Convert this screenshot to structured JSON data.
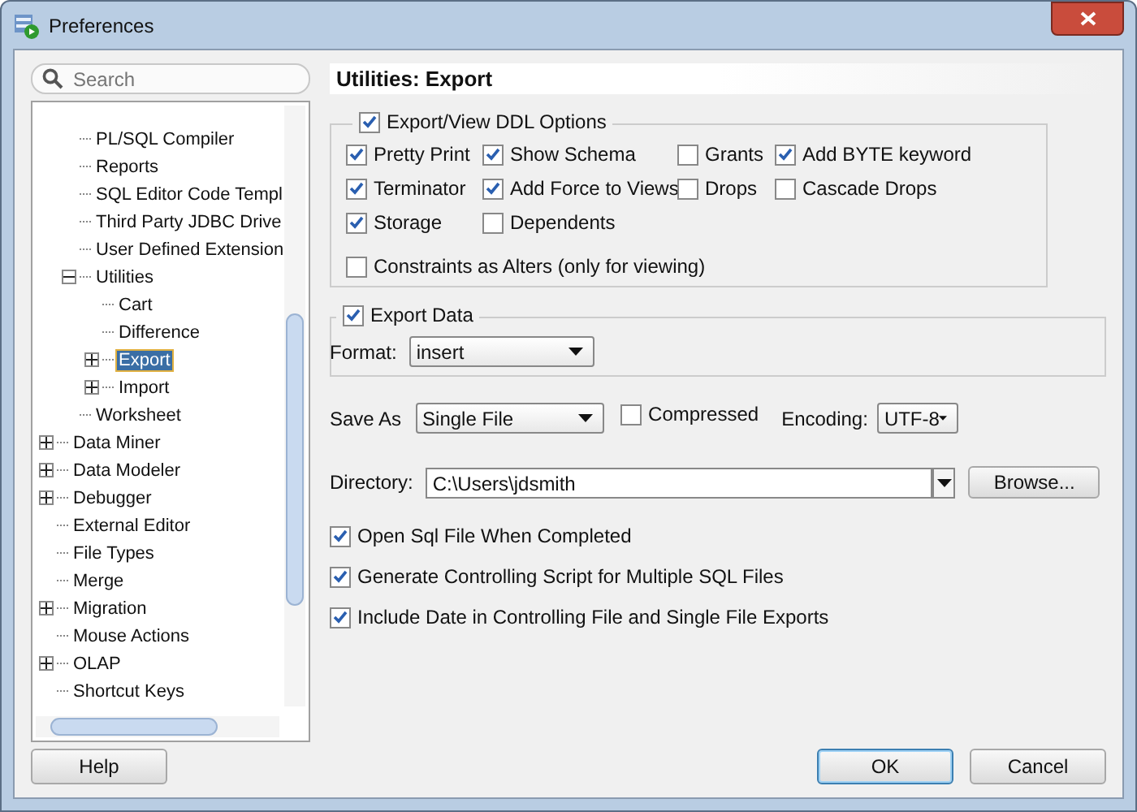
{
  "window": {
    "title": "Preferences"
  },
  "search": {
    "placeholder": "Search"
  },
  "tree": [
    {
      "children": [
        {
          "label": "PL/SQL Compiler",
          "selected": false
        },
        {
          "label": "Reports",
          "selected": false
        },
        {
          "label": "SQL Editor Code Templ",
          "selected": false
        },
        {
          "label": "Third Party JDBC Drive",
          "selected": false
        },
        {
          "label": "User Defined Extension",
          "selected": false
        },
        {
          "label": "Utilities",
          "selected": false,
          "expanded": true,
          "children": [
            {
              "label": "Cart",
              "selected": false
            },
            {
              "label": "Difference",
              "selected": false
            },
            {
              "label": "Export",
              "selected": true,
              "expanded": false
            },
            {
              "label": "Import",
              "selected": false,
              "expanded": false
            }
          ]
        },
        {
          "label": "Worksheet",
          "selected": false
        }
      ]
    },
    {
      "label": "Data Miner",
      "selected": false,
      "expanded": false
    },
    {
      "label": "Data Modeler",
      "selected": false,
      "expanded": false
    },
    {
      "label": "Debugger",
      "selected": false,
      "expanded": false
    },
    {
      "label": "External Editor",
      "selected": false
    },
    {
      "label": "File Types",
      "selected": false
    },
    {
      "label": "Merge",
      "selected": false
    },
    {
      "label": "Migration",
      "selected": false,
      "expanded": false
    },
    {
      "label": "Mouse Actions",
      "selected": false
    },
    {
      "label": "OLAP",
      "selected": false,
      "expanded": false
    },
    {
      "label": "Shortcut Keys",
      "selected": false
    }
  ],
  "help_button": "Help",
  "page": {
    "title": "Utilities: Export"
  },
  "ddl_options": {
    "label": "Export/View DDL Options",
    "checked": true,
    "rows": [
      [
        {
          "label": "Pretty Print",
          "checked": true
        },
        {
          "label": "Show Schema",
          "checked": true
        },
        {
          "label": "Grants",
          "checked": false
        },
        {
          "label": "Add BYTE keyword",
          "checked": true
        }
      ],
      [
        {
          "label": "Terminator",
          "checked": true
        },
        {
          "label": "Add Force to Views",
          "checked": true
        },
        {
          "label": "Drops",
          "checked": false
        },
        {
          "label": "Cascade Drops",
          "checked": false
        }
      ],
      [
        {
          "label": "Storage",
          "checked": true
        },
        {
          "label": "Dependents",
          "checked": false
        }
      ]
    ],
    "constraints": {
      "label": "Constraints as Alters (only for viewing)",
      "checked": false
    }
  },
  "export_data": {
    "label": "Export Data",
    "checked": true,
    "format_label": "Format:",
    "format_value": "insert"
  },
  "save_as": {
    "label": "Save As",
    "value": "Single File"
  },
  "compressed": {
    "label": "Compressed",
    "checked": false
  },
  "encoding": {
    "label": "Encoding:",
    "value": "UTF-8"
  },
  "directory": {
    "label": "Directory:",
    "value": "C:\\Users\\jdsmith",
    "browse_button": "Browse..."
  },
  "options": [
    {
      "label": "Open Sql File When Completed",
      "checked": true
    },
    {
      "label": "Generate Controlling Script for Multiple SQL Files",
      "checked": true
    },
    {
      "label": "Include Date in Controlling File and Single File Exports",
      "checked": true
    }
  ],
  "buttons": [
    {
      "label": "OK",
      "default": true
    },
    {
      "label": "Cancel",
      "default": false
    }
  ]
}
